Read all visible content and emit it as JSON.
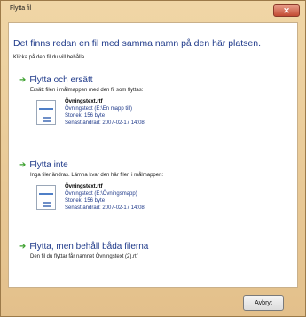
{
  "window": {
    "title": "Flytta fil",
    "close_label": "✕"
  },
  "header": {
    "headline": "Det finns redan en fil med samma namn på den här platsen.",
    "subline": "Klicka på den fil du vill behålla"
  },
  "options": [
    {
      "label": "Flytta och ersätt",
      "description": "Ersätt filen i målmappen med den fil som flyttas:",
      "file": {
        "name": "Övningstext.rtf",
        "location": "Övningstext (E:\\En mapp till)",
        "size": "Storlek: 156 byte",
        "modified": "Senast ändrad: 2007-02-17 14:08"
      }
    },
    {
      "label": "Flytta inte",
      "description": "Inga filer ändras. Lämna kvar den här filen i målmappen:",
      "file": {
        "name": "Övningstext.rtf",
        "location": "Övningstext (E:\\Övningsmapp)",
        "size": "Storlek: 156 byte",
        "modified": "Senast ändrad: 2007-02-17 14:08"
      }
    },
    {
      "label": "Flytta, men behåll båda filerna",
      "description": "Den fil du flyttar får namnet Övningstext (2).rtf"
    }
  ],
  "buttons": {
    "cancel_label": "Avbryt"
  },
  "colors": {
    "accent": "#1f3a8a",
    "arrow": "#3da12f",
    "frame": "#e7c99a"
  }
}
